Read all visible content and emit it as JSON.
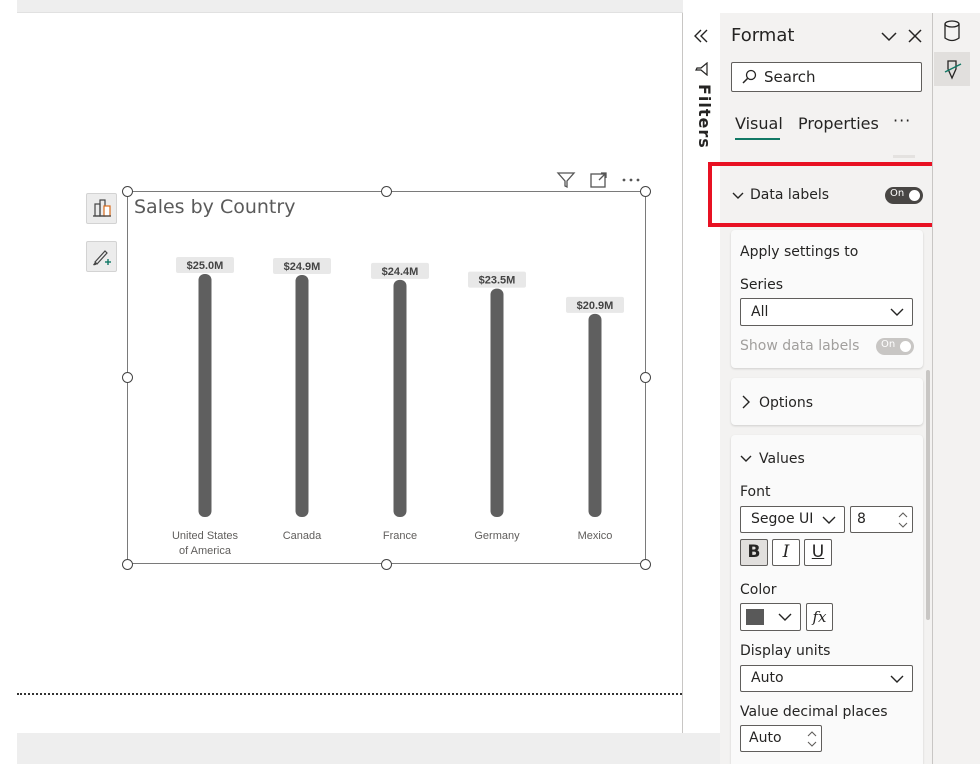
{
  "visual": {
    "title": "Sales by Country"
  },
  "chart_data": {
    "type": "bar",
    "title": "Sales by Country",
    "categories": [
      "United States of America",
      "Canada",
      "France",
      "Germany",
      "Mexico"
    ],
    "category_lines": [
      [
        "United States",
        "of America"
      ],
      [
        "Canada"
      ],
      [
        "France"
      ],
      [
        "Germany"
      ],
      [
        "Mexico"
      ]
    ],
    "values": [
      25.0,
      24.9,
      24.4,
      23.5,
      20.9
    ],
    "data_labels": [
      "$25.0M",
      "$24.9M",
      "$24.4M",
      "$23.5M",
      "$20.9M"
    ],
    "ylim": [
      0,
      25.0
    ],
    "bar_color": "#5f5f5f",
    "label_bg": "#e8e8e8",
    "grid": false,
    "xlabel": "",
    "ylabel": ""
  },
  "filters": {
    "label": "Filters"
  },
  "format": {
    "title": "Format",
    "search_placeholder": "Search",
    "tabs": [
      "Visual",
      "Properties"
    ],
    "more": "···",
    "data_labels": {
      "heading": "Data labels",
      "toggle": "On"
    },
    "apply_settings": {
      "heading": "Apply settings to",
      "series_label": "Series",
      "series_value": "All",
      "show_label": "Show data labels",
      "show_toggle": "On"
    },
    "options": {
      "heading": "Options"
    },
    "values": {
      "heading": "Values",
      "font_label": "Font",
      "font_family": "Segoe UI",
      "font_size": "8",
      "bold": "B",
      "italic": "I",
      "underline": "U",
      "color_label": "Color",
      "color_value": "#595959",
      "fx": "fx",
      "display_units_label": "Display units",
      "display_units_value": "Auto",
      "decimal_label": "Value decimal places",
      "decimal_value": "Auto"
    }
  },
  "colors": {
    "accent": "#117865",
    "highlight": "#e81123",
    "toggle_on": "#484644"
  }
}
